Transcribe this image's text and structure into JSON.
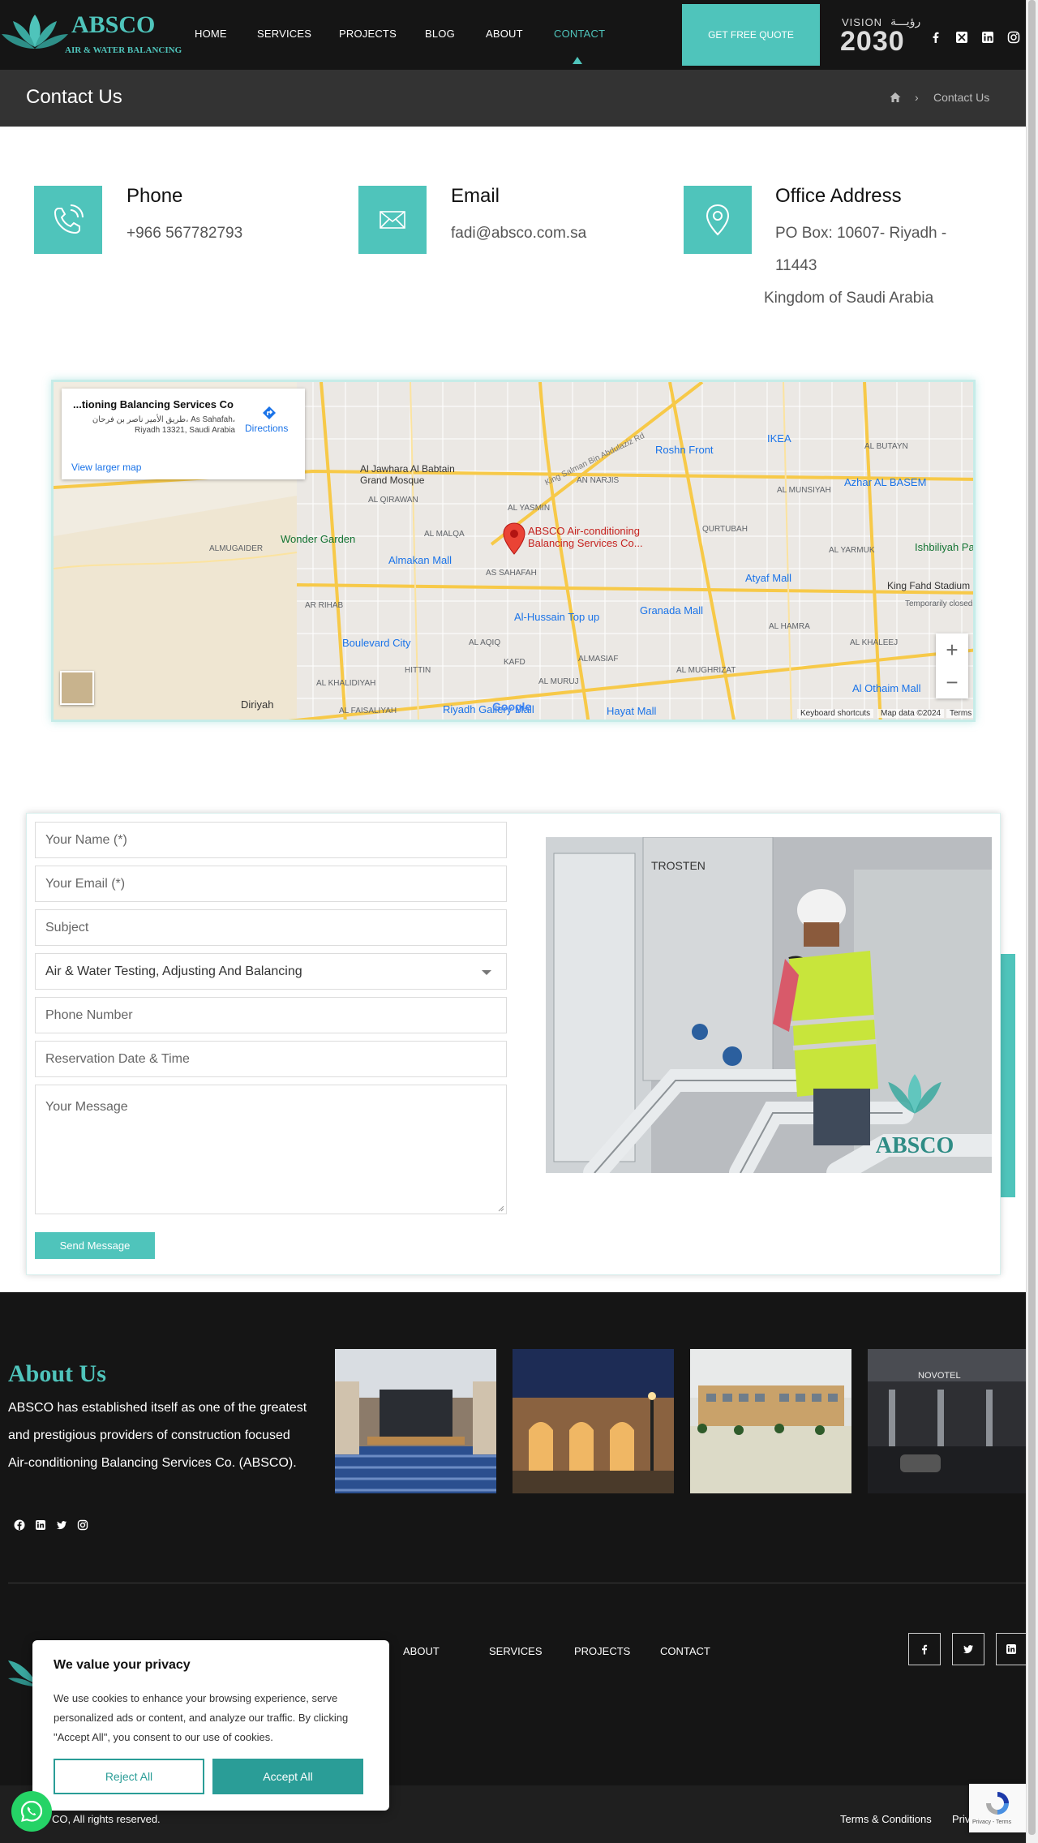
{
  "header": {
    "logo_text": "ABSCO",
    "logo_sub": "AIR & WATER BALANCING",
    "nav": [
      {
        "label": "HOME"
      },
      {
        "label": "SERVICES"
      },
      {
        "label": "PROJECTS"
      },
      {
        "label": "BLOG"
      },
      {
        "label": "ABOUT"
      },
      {
        "label": "CONTACT",
        "active": true
      }
    ],
    "quote_button": "GET FREE QUOTE",
    "vision_label": "VISION",
    "vision_arabic": "رؤيـــة",
    "vision_year": "2030",
    "social_icons": [
      "facebook-icon",
      "x-icon",
      "linkedin-icon",
      "instagram-icon"
    ]
  },
  "title_bar": {
    "title": "Contact Us",
    "breadcrumb_current": "Contact Us",
    "breadcrumb_sep": "›"
  },
  "contact": {
    "phone": {
      "title": "Phone",
      "value": "+966 567782793",
      "icon": "phone-icon"
    },
    "email": {
      "title": "Email",
      "value": "fadi@absco.com.sa",
      "icon": "envelope-icon"
    },
    "address": {
      "title": "Office Address",
      "line1": "PO Box: 10607- Riyadh -",
      "line2": "11443",
      "line3": "Kingdom of Saudi Arabia",
      "icon": "map-pin-icon"
    }
  },
  "map": {
    "popup_title": "...tioning Balancing Services Co",
    "popup_address": "طريق الأمير ناصر بن فرحان، As Sahafah، Riyadh 13321, Saudi Arabia",
    "directions": "Directions",
    "view_larger": "View larger map",
    "marker_label_1": "ABSCO Air-conditioning",
    "marker_label_2": "Balancing Services Co...",
    "labels": [
      "Al Jawhara Al Babtain",
      "Grand Mosque",
      "AN NARJIS",
      "Roshn Front",
      "IKEA",
      "AL BUTAYN",
      "AL QIRAWAN",
      "AL YASMIN",
      "AL MUNSIYAH",
      "Azhar AL BASEM",
      "Wonder Garden",
      "AL MALQA",
      "QURTUBAH",
      "AL YARMUK",
      "Ishbiliyah Pa",
      "ALMUGAIDER",
      "Almakan Mall",
      "AS SAHAFAH",
      "Atyaf Mall",
      "King Fahd Stadium",
      "Temporarily closed",
      "AR RIHAB",
      "Al-Hussain Top up",
      "Granada Mall",
      "AL HAMRA",
      "Boulevard City",
      "AL AQIQ",
      "AL KHALEEJ",
      "HITTIN",
      "ALMASIAF",
      "AL MUGHRIZAT",
      "AL KHALIDIYAH",
      "KAFD",
      "AL MURUJ",
      "Al Othaim Mall",
      "Diriyah",
      "AL FAISALIYAH",
      "Riyadh Gallery Mall",
      "Hayat Mall",
      "King Salman Bin Abdulaziz Rd"
    ],
    "footer_keyboard": "Keyboard shortcuts",
    "footer_data": "Map data ©2024",
    "footer_terms": "Terms",
    "google": "Google"
  },
  "form": {
    "name_placeholder": "Your Name (*)",
    "email_placeholder": "Your Email (*)",
    "subject_placeholder": "Subject",
    "service_selected": "Air & Water Testing, Adjusting And Balancing",
    "phone_placeholder": "Phone Number",
    "date_placeholder": "Reservation Date & Time",
    "message_placeholder": "Your Message",
    "send_button": "Send Message"
  },
  "footer": {
    "about_title": "About Us",
    "about_text": "ABSCO has established itself as one of the greatest and prestigious providers of construction focused Air-conditioning Balancing Services Co. (ABSCO).",
    "nav": [
      "ABOUT",
      "SERVICES",
      "PROJECTS",
      "CONTACT"
    ],
    "copyright": "CO, All rights reserved.",
    "terms": "Terms & Conditions",
    "privacy": "Priv",
    "gallery_sign": "NOVOTEL"
  },
  "cookie": {
    "title": "We value your privacy",
    "text": "We use cookies to enhance your browsing experience, serve personalized ads or content, and analyze our traffic. By clicking \"Accept All\", you consent to our use of cookies.",
    "reject": "Reject All",
    "accept": "Accept All"
  },
  "recaptcha": {
    "label": "Privacy - Terms"
  },
  "colors": {
    "accent": "#4fc4bb",
    "dark": "#151515",
    "titlebar": "#333333",
    "cookie_button": "#2a9d97",
    "whatsapp": "#25d366"
  }
}
